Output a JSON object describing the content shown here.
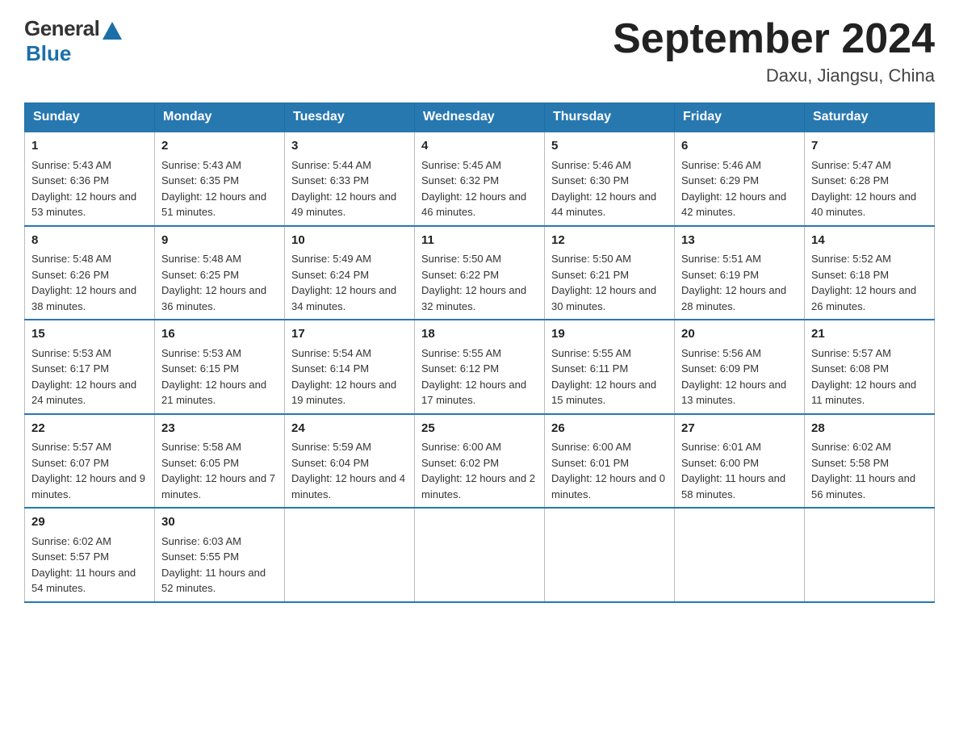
{
  "logo": {
    "general": "General",
    "blue": "Blue"
  },
  "title": "September 2024",
  "location": "Daxu, Jiangsu, China",
  "days_header": [
    "Sunday",
    "Monday",
    "Tuesday",
    "Wednesday",
    "Thursday",
    "Friday",
    "Saturday"
  ],
  "weeks": [
    [
      {
        "day": "1",
        "sunrise": "5:43 AM",
        "sunset": "6:36 PM",
        "daylight": "12 hours and 53 minutes."
      },
      {
        "day": "2",
        "sunrise": "5:43 AM",
        "sunset": "6:35 PM",
        "daylight": "12 hours and 51 minutes."
      },
      {
        "day": "3",
        "sunrise": "5:44 AM",
        "sunset": "6:33 PM",
        "daylight": "12 hours and 49 minutes."
      },
      {
        "day": "4",
        "sunrise": "5:45 AM",
        "sunset": "6:32 PM",
        "daylight": "12 hours and 46 minutes."
      },
      {
        "day": "5",
        "sunrise": "5:46 AM",
        "sunset": "6:30 PM",
        "daylight": "12 hours and 44 minutes."
      },
      {
        "day": "6",
        "sunrise": "5:46 AM",
        "sunset": "6:29 PM",
        "daylight": "12 hours and 42 minutes."
      },
      {
        "day": "7",
        "sunrise": "5:47 AM",
        "sunset": "6:28 PM",
        "daylight": "12 hours and 40 minutes."
      }
    ],
    [
      {
        "day": "8",
        "sunrise": "5:48 AM",
        "sunset": "6:26 PM",
        "daylight": "12 hours and 38 minutes."
      },
      {
        "day": "9",
        "sunrise": "5:48 AM",
        "sunset": "6:25 PM",
        "daylight": "12 hours and 36 minutes."
      },
      {
        "day": "10",
        "sunrise": "5:49 AM",
        "sunset": "6:24 PM",
        "daylight": "12 hours and 34 minutes."
      },
      {
        "day": "11",
        "sunrise": "5:50 AM",
        "sunset": "6:22 PM",
        "daylight": "12 hours and 32 minutes."
      },
      {
        "day": "12",
        "sunrise": "5:50 AM",
        "sunset": "6:21 PM",
        "daylight": "12 hours and 30 minutes."
      },
      {
        "day": "13",
        "sunrise": "5:51 AM",
        "sunset": "6:19 PM",
        "daylight": "12 hours and 28 minutes."
      },
      {
        "day": "14",
        "sunrise": "5:52 AM",
        "sunset": "6:18 PM",
        "daylight": "12 hours and 26 minutes."
      }
    ],
    [
      {
        "day": "15",
        "sunrise": "5:53 AM",
        "sunset": "6:17 PM",
        "daylight": "12 hours and 24 minutes."
      },
      {
        "day": "16",
        "sunrise": "5:53 AM",
        "sunset": "6:15 PM",
        "daylight": "12 hours and 21 minutes."
      },
      {
        "day": "17",
        "sunrise": "5:54 AM",
        "sunset": "6:14 PM",
        "daylight": "12 hours and 19 minutes."
      },
      {
        "day": "18",
        "sunrise": "5:55 AM",
        "sunset": "6:12 PM",
        "daylight": "12 hours and 17 minutes."
      },
      {
        "day": "19",
        "sunrise": "5:55 AM",
        "sunset": "6:11 PM",
        "daylight": "12 hours and 15 minutes."
      },
      {
        "day": "20",
        "sunrise": "5:56 AM",
        "sunset": "6:09 PM",
        "daylight": "12 hours and 13 minutes."
      },
      {
        "day": "21",
        "sunrise": "5:57 AM",
        "sunset": "6:08 PM",
        "daylight": "12 hours and 11 minutes."
      }
    ],
    [
      {
        "day": "22",
        "sunrise": "5:57 AM",
        "sunset": "6:07 PM",
        "daylight": "12 hours and 9 minutes."
      },
      {
        "day": "23",
        "sunrise": "5:58 AM",
        "sunset": "6:05 PM",
        "daylight": "12 hours and 7 minutes."
      },
      {
        "day": "24",
        "sunrise": "5:59 AM",
        "sunset": "6:04 PM",
        "daylight": "12 hours and 4 minutes."
      },
      {
        "day": "25",
        "sunrise": "6:00 AM",
        "sunset": "6:02 PM",
        "daylight": "12 hours and 2 minutes."
      },
      {
        "day": "26",
        "sunrise": "6:00 AM",
        "sunset": "6:01 PM",
        "daylight": "12 hours and 0 minutes."
      },
      {
        "day": "27",
        "sunrise": "6:01 AM",
        "sunset": "6:00 PM",
        "daylight": "11 hours and 58 minutes."
      },
      {
        "day": "28",
        "sunrise": "6:02 AM",
        "sunset": "5:58 PM",
        "daylight": "11 hours and 56 minutes."
      }
    ],
    [
      {
        "day": "29",
        "sunrise": "6:02 AM",
        "sunset": "5:57 PM",
        "daylight": "11 hours and 54 minutes."
      },
      {
        "day": "30",
        "sunrise": "6:03 AM",
        "sunset": "5:55 PM",
        "daylight": "11 hours and 52 minutes."
      },
      null,
      null,
      null,
      null,
      null
    ]
  ],
  "labels": {
    "sunrise": "Sunrise:",
    "sunset": "Sunset:",
    "daylight": "Daylight:"
  }
}
